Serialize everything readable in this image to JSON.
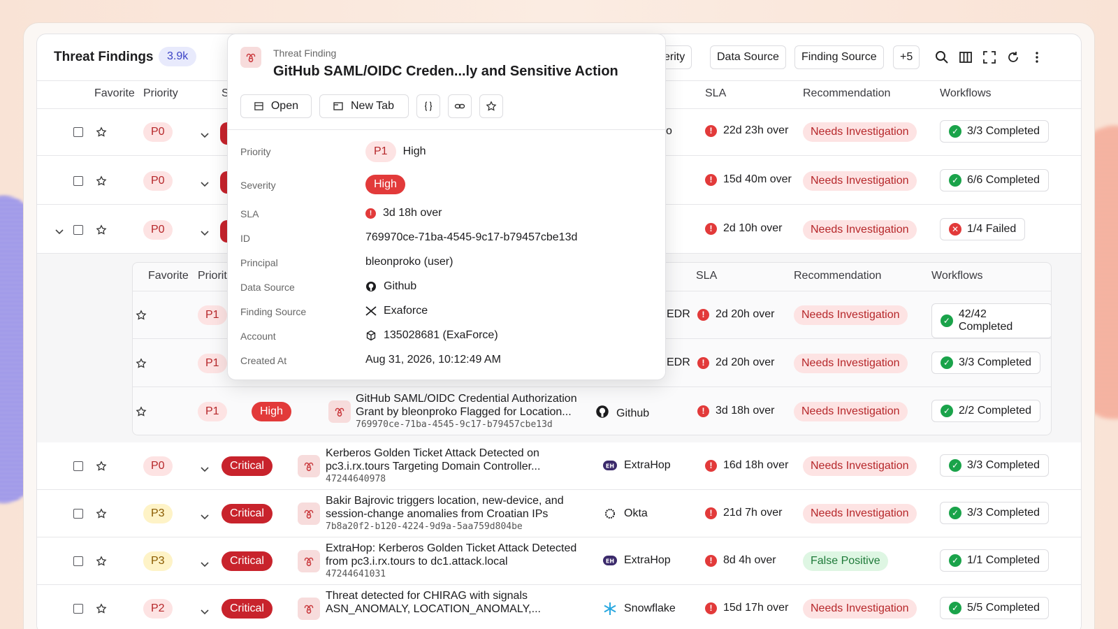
{
  "header": {
    "title": "Threat Findings",
    "count": "3.9k",
    "filters": [
      "verity",
      "Data Source",
      "Finding Source",
      "+5"
    ]
  },
  "columns": {
    "favorite": "Favorite",
    "priority": "Priority",
    "s": "S",
    "sla": "SLA",
    "recommendation": "Recommendation",
    "workflows": "Workflows"
  },
  "nested_columns": {
    "favorite": "Favorite",
    "priority": "Priorit",
    "sla": "SLA",
    "recommendation": "Recommendation",
    "workflows": "Workflows"
  },
  "rows_top": [
    {
      "priority": "P0",
      "sla_tail": "o",
      "sla": "22d 23h over",
      "recommendation": "Needs Investigation",
      "workflow": "3/3 Completed",
      "status": "ok"
    },
    {
      "priority": "P0",
      "sla_tail": "",
      "sla": "15d 40m over",
      "recommendation": "Needs Investigation",
      "workflow": "6/6 Completed",
      "status": "ok"
    },
    {
      "priority": "P0",
      "sla_tail": "",
      "sla": "2d 10h over",
      "recommendation": "Needs Investigation",
      "workflow": "1/4 Failed",
      "status": "fail"
    }
  ],
  "nested_rows": [
    {
      "priority": "P1",
      "src_tail": "EDR",
      "sla": "2d 20h over",
      "recommendation": "Needs Investigation",
      "workflow": "42/42 Completed"
    },
    {
      "priority": "P1",
      "src_tail": "EDR",
      "sla": "2d 20h over",
      "recommendation": "Needs Investigation",
      "workflow": "3/3 Completed"
    },
    {
      "priority": "P1",
      "severity": "High",
      "title1": "GitHub SAML/OIDC Credential Authorization",
      "title2": "Grant by bleonproko Flagged for Location...",
      "id": "769970ce-71ba-4545-9c17-b79457cbe13d",
      "source": "Github",
      "sla": "3d 18h over",
      "recommendation": "Needs Investigation",
      "workflow": "2/2 Completed"
    }
  ],
  "rows_bottom": [
    {
      "priority": "P0",
      "pclass": "p0",
      "severity": "Critical",
      "title1": "Kerberos Golden Ticket Attack Detected on",
      "title2": "pc3.i.rx.tours Targeting Domain Controller...",
      "id": "47244640978",
      "source": "ExtraHop",
      "source_icon": "extrahop-icon",
      "sla": "16d 18h over",
      "recommendation": "Needs Investigation",
      "workflow": "3/3 Completed"
    },
    {
      "priority": "P3",
      "pclass": "p3",
      "severity": "Critical",
      "title1": "Bakir Bajrovic triggers location, new-device, and",
      "title2": "session-change anomalies from Croatian IPs",
      "id": "7b8a20f2-b120-4224-9d9a-5aa759d804be",
      "source": "Okta",
      "source_icon": "okta-icon",
      "sla": "21d 7h over",
      "recommendation": "Needs Investigation",
      "workflow": "3/3 Completed"
    },
    {
      "priority": "P3",
      "pclass": "p3",
      "severity": "Critical",
      "title1": "ExtraHop: Kerberos Golden Ticket Attack Detected",
      "title2": "from pc3.i.rx.tours to dc1.attack.local",
      "id": "47244641031",
      "source": "ExtraHop",
      "source_icon": "extrahop-icon",
      "sla": "8d 4h over",
      "recommendation": "False Positive",
      "workflow": "1/1 Completed"
    },
    {
      "priority": "P2",
      "pclass": "p2",
      "severity": "Critical",
      "title1": "Threat detected for CHIRAG with signals",
      "title2": "ASN_ANOMALY, LOCATION_ANOMALY,...",
      "id": "",
      "source": "Snowflake",
      "source_icon": "snowflake-icon",
      "sla": "15d 17h over",
      "recommendation": "Needs Investigation",
      "workflow": "5/5 Completed"
    }
  ],
  "popup": {
    "kind": "Threat Finding",
    "title": "GitHub SAML/OIDC Creden...ly and Sensitive Action",
    "open_label": "Open",
    "newtab_label": "New Tab",
    "fields": {
      "priority_label": "Priority",
      "priority_badge": "P1",
      "priority_text": "High",
      "severity_label": "Severity",
      "severity": "High",
      "sla_label": "SLA",
      "sla": "3d 18h over",
      "id_label": "ID",
      "id": "769970ce-71ba-4545-9c17-b79457cbe13d",
      "principal_label": "Principal",
      "principal": "bleonproko (user)",
      "datasource_label": "Data Source",
      "datasource": "Github",
      "findingsource_label": "Finding Source",
      "findingsource": "Exaforce",
      "account_label": "Account",
      "account": "135028681 (ExaForce)",
      "created_label": "Created At",
      "created": "Aug 31, 2026, 10:12:49 AM"
    }
  },
  "colors": {
    "accent": "#3c44c6",
    "critical": "#c8232c",
    "high": "#e23a3a",
    "success": "#1aa34a"
  }
}
